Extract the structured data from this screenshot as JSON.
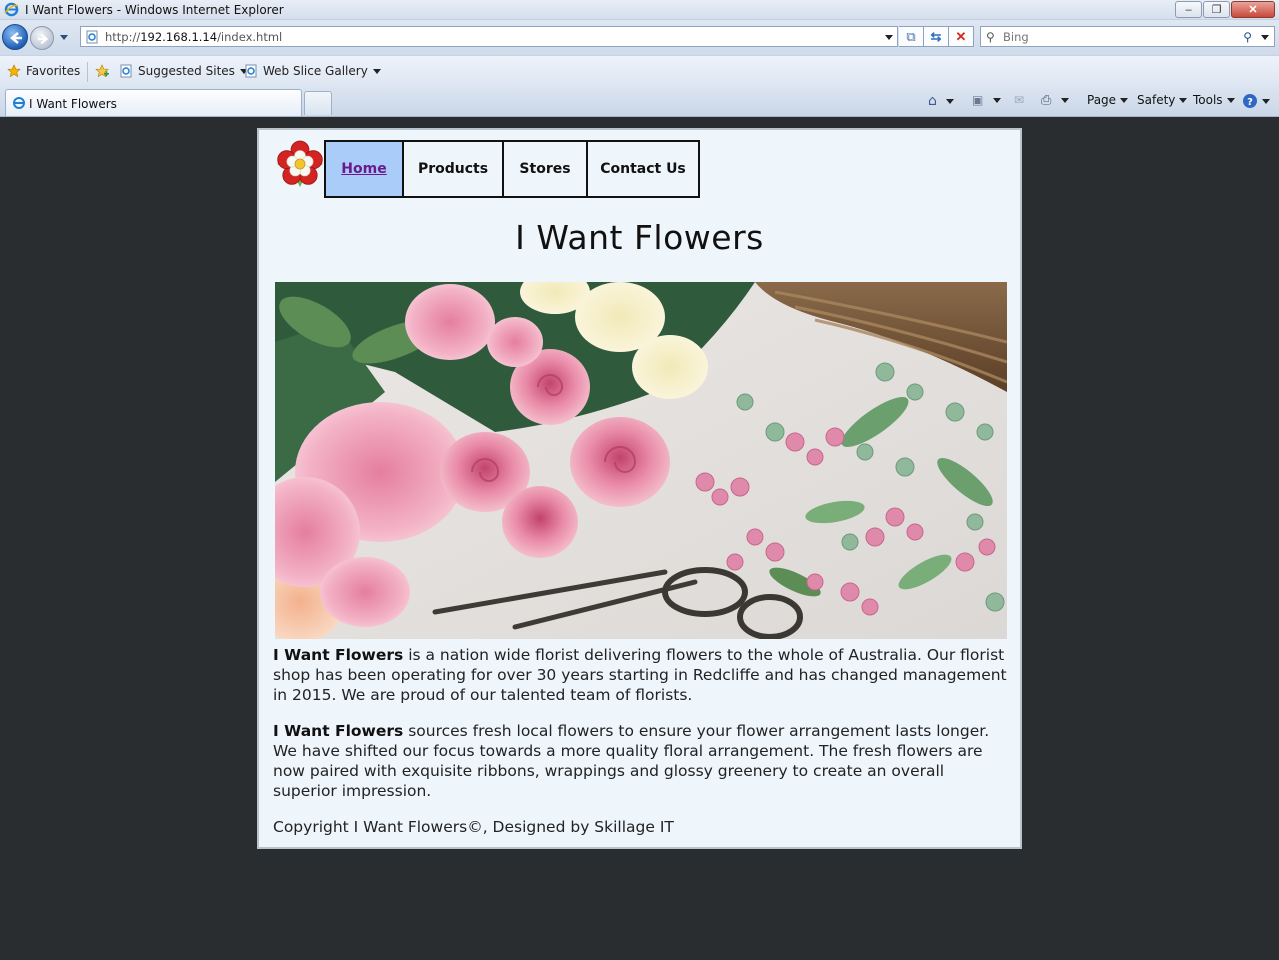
{
  "window": {
    "title": "I Want Flowers - Windows Internet Explorer",
    "buttons": {
      "minimize": "–",
      "maximize": "❐",
      "close": "✕"
    }
  },
  "address_bar": {
    "url_prefix": "http://",
    "url_host": "192.168.1.14",
    "url_path": "/index.html"
  },
  "search": {
    "placeholder": "Bing"
  },
  "favorites_bar": {
    "favorites_label": "Favorites",
    "items": [
      {
        "label": "Suggested Sites"
      },
      {
        "label": "Web Slice Gallery"
      }
    ]
  },
  "tab": {
    "label": "I Want Flowers"
  },
  "command_bar": {
    "page_label": "Page",
    "safety_label": "Safety",
    "tools_label": "Tools"
  },
  "site": {
    "nav": [
      {
        "label": "Home",
        "active": true
      },
      {
        "label": "Products",
        "active": false
      },
      {
        "label": "Stores",
        "active": false
      },
      {
        "label": "Contact Us",
        "active": false
      }
    ],
    "title": "I Want Flowers",
    "paragraphs": [
      {
        "brand": "I Want Flowers",
        "text": " is a nation wide florist delivering flowers to the whole of Australia. Our florist shop has been operating for over 30 years starting in Redcliffe and has changed management in 2015. We are proud of our talented team of florists."
      },
      {
        "brand": "I Want Flowers",
        "text": " sources fresh local flowers to ensure your flower arrangement lasts longer. We have shifted our focus towards a more quality floral arrangement. The fresh flowers are now paired with exquisite ribbons, wrappings and glossy greenery to create an overall superior impression."
      }
    ],
    "footer": "Copyright I Want Flowers©, Designed by Skillage IT"
  },
  "colors": {
    "page_bg": "#eef6fc",
    "viewport_bg": "#2a2d30",
    "nav_active_bg": "#a9cdf8",
    "nav_active_text": "#6a1a8d"
  }
}
